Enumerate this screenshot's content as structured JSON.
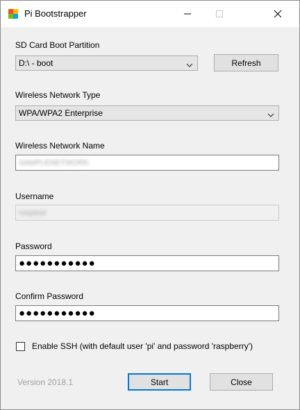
{
  "window": {
    "title": "Pi Bootstrapper"
  },
  "sd_card": {
    "label": "SD Card Boot Partition",
    "selected": "D:\\ - boot",
    "refresh_label": "Refresh"
  },
  "wireless_type": {
    "label": "Wireless Network Type",
    "selected": "WPA/WPA2 Enterprise"
  },
  "network_name": {
    "label": "Wireless Network Name",
    "value": "SAMPLENETWORK"
  },
  "username": {
    "label": "Username",
    "value": "rasptest"
  },
  "password": {
    "label": "Password",
    "value": "●●●●●●●●●●●"
  },
  "confirm_password": {
    "label": "Confirm Password",
    "value": "●●●●●●●●●●●"
  },
  "ssh": {
    "label": "Enable SSH (with default user 'pi' and password 'raspberry')",
    "checked": false
  },
  "footer": {
    "version": "Version 2018.1",
    "start_label": "Start",
    "close_label": "Close"
  }
}
